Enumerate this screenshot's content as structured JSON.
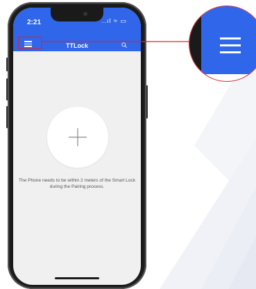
{
  "status_bar": {
    "time": "2:21",
    "icons": "..ıl ≈ ▭"
  },
  "app_bar": {
    "title": "TTLock",
    "menu_icon": "hamburger-menu-icon",
    "search_icon": "search-icon"
  },
  "main": {
    "add_button_icon": "plus-icon",
    "hint": "The Phone needs to be within 2 meters of the Smart Lock during the Pairing process."
  },
  "colors": {
    "accent": "#2f66ea",
    "highlight": "#d9262c",
    "screen_bg": "#f0f0f0"
  },
  "callout": {
    "icon": "hamburger-menu-icon"
  }
}
